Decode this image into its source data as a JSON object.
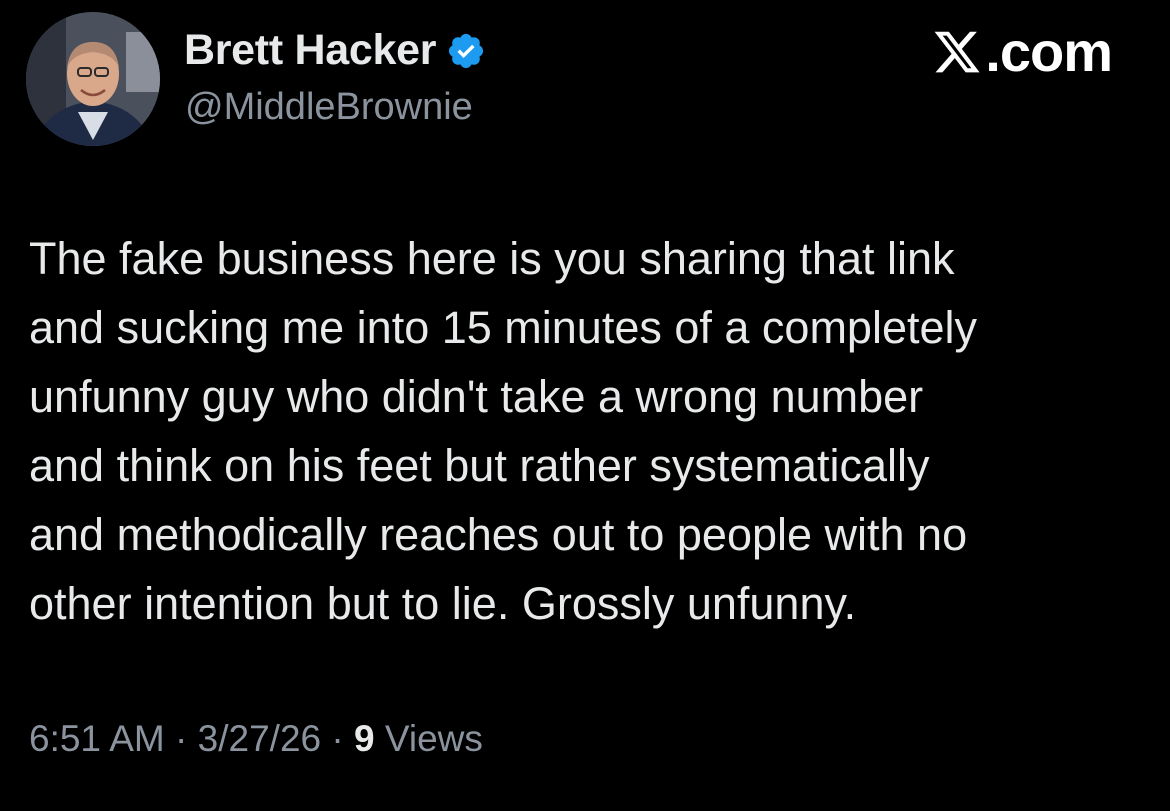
{
  "author": {
    "display_name": "Brett Hacker",
    "handle": "@MiddleBrownie",
    "verified": true,
    "avatar_icon": "profile-photo",
    "badge_color": "#1d9bf0"
  },
  "brand": {
    "icon": "x-logo-icon",
    "text": ".com"
  },
  "tweet": {
    "text": "The fake business here is you sharing that link\nand sucking me into 15 minutes of a completely\nunfunny guy who didn't take a wrong number\nand think on his feet but rather systematically\nand methodically reaches out to people with no\nother intention but to lie. Grossly unfunny."
  },
  "meta": {
    "time": "6:51 AM",
    "separator": " · ",
    "date": "3/27/26",
    "views_count": "9",
    "views_label": " Views"
  },
  "colors": {
    "background": "#000000",
    "text_primary": "#e7e9ea",
    "text_secondary": "#8b949e",
    "accent": "#1d9bf0"
  }
}
